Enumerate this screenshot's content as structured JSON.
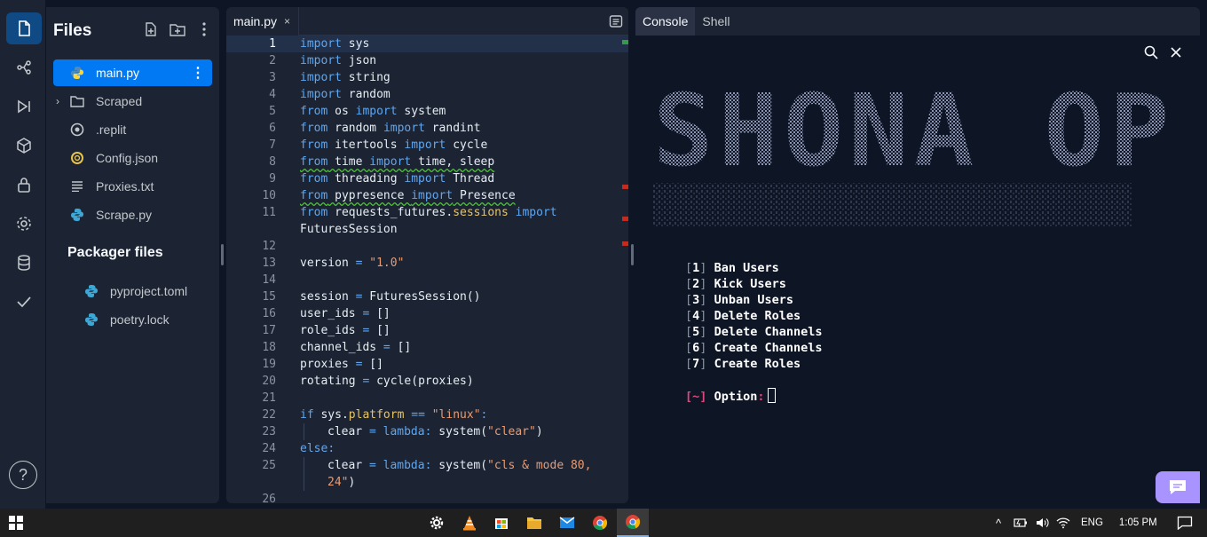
{
  "files_panel": {
    "title": "Files",
    "items": [
      {
        "label": "main.py",
        "icon": "python-icon",
        "active": true
      },
      {
        "label": "Scraped",
        "icon": "folder-icon",
        "active": false
      },
      {
        "label": ".replit",
        "icon": "replit-config-icon",
        "active": false
      },
      {
        "label": "Config.json",
        "icon": "json-icon",
        "active": false
      },
      {
        "label": "Proxies.txt",
        "icon": "text-file-icon",
        "active": false
      },
      {
        "label": "Scrape.py",
        "icon": "python-icon",
        "active": false
      }
    ],
    "packager_title": "Packager files",
    "packager_items": [
      {
        "label": "pyproject.toml",
        "icon": "python-icon"
      },
      {
        "label": "poetry.lock",
        "icon": "python-icon"
      }
    ],
    "help_label": "?"
  },
  "editor": {
    "tab_label": "main.py",
    "tab_close": "×",
    "current_line": 1,
    "lines": [
      {
        "n": "1"
      },
      {
        "n": "2"
      },
      {
        "n": "3"
      },
      {
        "n": "4"
      },
      {
        "n": "5"
      },
      {
        "n": "6"
      },
      {
        "n": "7"
      },
      {
        "n": "8"
      },
      {
        "n": "9"
      },
      {
        "n": "10"
      },
      {
        "n": "11"
      },
      {
        "n": ""
      },
      {
        "n": "12"
      },
      {
        "n": "13"
      },
      {
        "n": "14"
      },
      {
        "n": "15"
      },
      {
        "n": "16"
      },
      {
        "n": "17"
      },
      {
        "n": "18"
      },
      {
        "n": "19"
      },
      {
        "n": "20"
      },
      {
        "n": "21"
      },
      {
        "n": "22"
      },
      {
        "n": "23"
      },
      {
        "n": "24"
      },
      {
        "n": "25"
      },
      {
        "n": ""
      },
      {
        "n": "26"
      }
    ],
    "code_tokens": {
      "import": "import",
      "from": "from",
      "sys": " sys",
      "json": " json",
      "string": " string",
      "random": " random",
      "os": " os ",
      "system": " system",
      "random2": " random ",
      "randint": " randint",
      "itertools": " itertools ",
      "cycle": " cycle",
      "time": " time ",
      "time_sleep": " time, sleep",
      "threading": " threading ",
      "thread": " Thread",
      "pypresence": " pypresence ",
      "presence": " Presence",
      "requests": " requests_futures.",
      "sessions": "sessions",
      "import_trail": " import",
      "futures_session": "FuturesSession",
      "version_lhs": "version ",
      "eq": "=",
      "version_val": " \"1.0\"",
      "session_line": "session ",
      "session_rhs": " FuturesSession()",
      "user_ids": "user_ids ",
      "role_ids": "role_ids ",
      "channel_ids": "channel_ids ",
      "proxies": "proxies ",
      "empty_list": " []",
      "rotating": "rotating ",
      "rotating_rhs": " cycle(proxies)",
      "if": "if",
      "sys_dot": " sys.",
      "platform": "platform",
      "eqeq": " == ",
      "linux": "\"linux\"",
      "colon": ":",
      "clear": "clear ",
      "lambda": " lambda",
      "system_call": " system(",
      "clear_str": "\"clear\"",
      "close_paren": ")",
      "else": "else",
      "cls_str": "\"cls & mode 80,",
      "cls_str2": "24\"",
      "cls_close": ")"
    }
  },
  "console": {
    "tabs": [
      "Console",
      "Shell"
    ],
    "active_tab": "Console",
    "banner": "SHONA OP",
    "menu": [
      {
        "num": "1",
        "label": "Ban Users"
      },
      {
        "num": "2",
        "label": "Kick Users"
      },
      {
        "num": "3",
        "label": "Unban Users"
      },
      {
        "num": "4",
        "label": "Delete Roles"
      },
      {
        "num": "5",
        "label": "Delete Channels"
      },
      {
        "num": "6",
        "label": "Create Channels"
      },
      {
        "num": "7",
        "label": "Create Roles"
      }
    ],
    "prompt_marker": "~",
    "prompt_label": "Option",
    "prompt_colon": ":"
  },
  "taskbar": {
    "language": "ENG",
    "time": "1:05 PM"
  },
  "colors": {
    "accent": "#0079f2",
    "background": "#0e1525",
    "panel": "#1c2333",
    "keyword": "#5ea7f0",
    "string": "#e79c73",
    "prompt": "#e0457b",
    "chat_button": "#a994ff"
  }
}
